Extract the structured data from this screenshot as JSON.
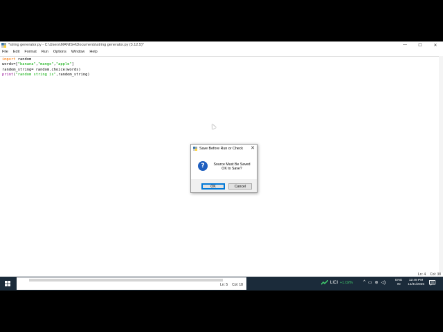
{
  "window": {
    "title": "*string generator.py - C:\\Users\\MANISH\\Documents\\string generator.py (3.12.5)*",
    "min": "—",
    "max": "☐",
    "close": "✕"
  },
  "menu": [
    "File",
    "Edit",
    "Format",
    "Run",
    "Options",
    "Window",
    "Help"
  ],
  "code": {
    "l1_kw": "import",
    "l1_rest": " random",
    "l2_a": "words=[",
    "l2_s1": "\"banana\"",
    "l2_c1": ",",
    "l2_s2": "\"mango\"",
    "l2_c2": ",",
    "l2_s3": "\"apple\"",
    "l2_b": "]",
    "l3": "random_string= random.choice(words)",
    "l4_bi": "print",
    "l4_a": "(",
    "l4_s": "\"random string is\"",
    "l4_b": ",random_string)"
  },
  "editor_status": {
    "ln": "Ln: 4",
    "col": "Col: 38"
  },
  "dialog": {
    "title": "Save Before Run or Check",
    "close": "✕",
    "icon": "?",
    "message_line1": "Source Must Be Saved",
    "message_line2": "OK to Save?",
    "ok": "OK",
    "cancel": "Cancel"
  },
  "taskbar": {
    "search_status": {
      "ln": "Ln: 5",
      "col": "Col: 18"
    },
    "stock_name": "LICI",
    "stock_change": "+1.02%",
    "lang_line1": "ENG",
    "lang_line2": "IN",
    "time": "12:49 PM",
    "date": "12/31/2025",
    "tray_icons": [
      "chevron-up-icon",
      "battery-icon",
      "network-icon",
      "volume-icon"
    ],
    "tray_glyphs": [
      "^",
      "▭",
      "⊛",
      "◁)"
    ]
  },
  "colors": {
    "keyword": "#ff7700",
    "string": "#00aa00",
    "builtin": "#900090",
    "taskbar": "#1b2b3a",
    "stock_up": "#3fc46a"
  }
}
